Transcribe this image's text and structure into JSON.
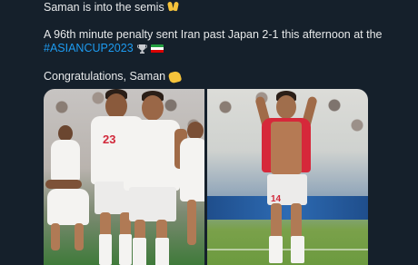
{
  "tweet": {
    "line1": "Saman is into the semis",
    "line2": "A 96th minute penalty sent Iran past Japan 2-1 this afternoon at the",
    "hashtag": "#ASIANCUP2023",
    "line4": "Congratulations, Saman"
  },
  "icons": {
    "line1_emoji": "raised-hands-icon",
    "trophy": "trophy-icon",
    "flag": "iran-flag-icon",
    "line4_emoji": "clapping-hands-icon"
  },
  "colors": {
    "background": "#15202b",
    "text": "#e7e9ea",
    "hashtag": "#1d9bf0",
    "shirt_number": "#d1293b"
  },
  "media": {
    "left": {
      "shirt_number_1": "23",
      "shirt_number_2": ""
    },
    "right": {
      "shorts_number": "14"
    }
  }
}
